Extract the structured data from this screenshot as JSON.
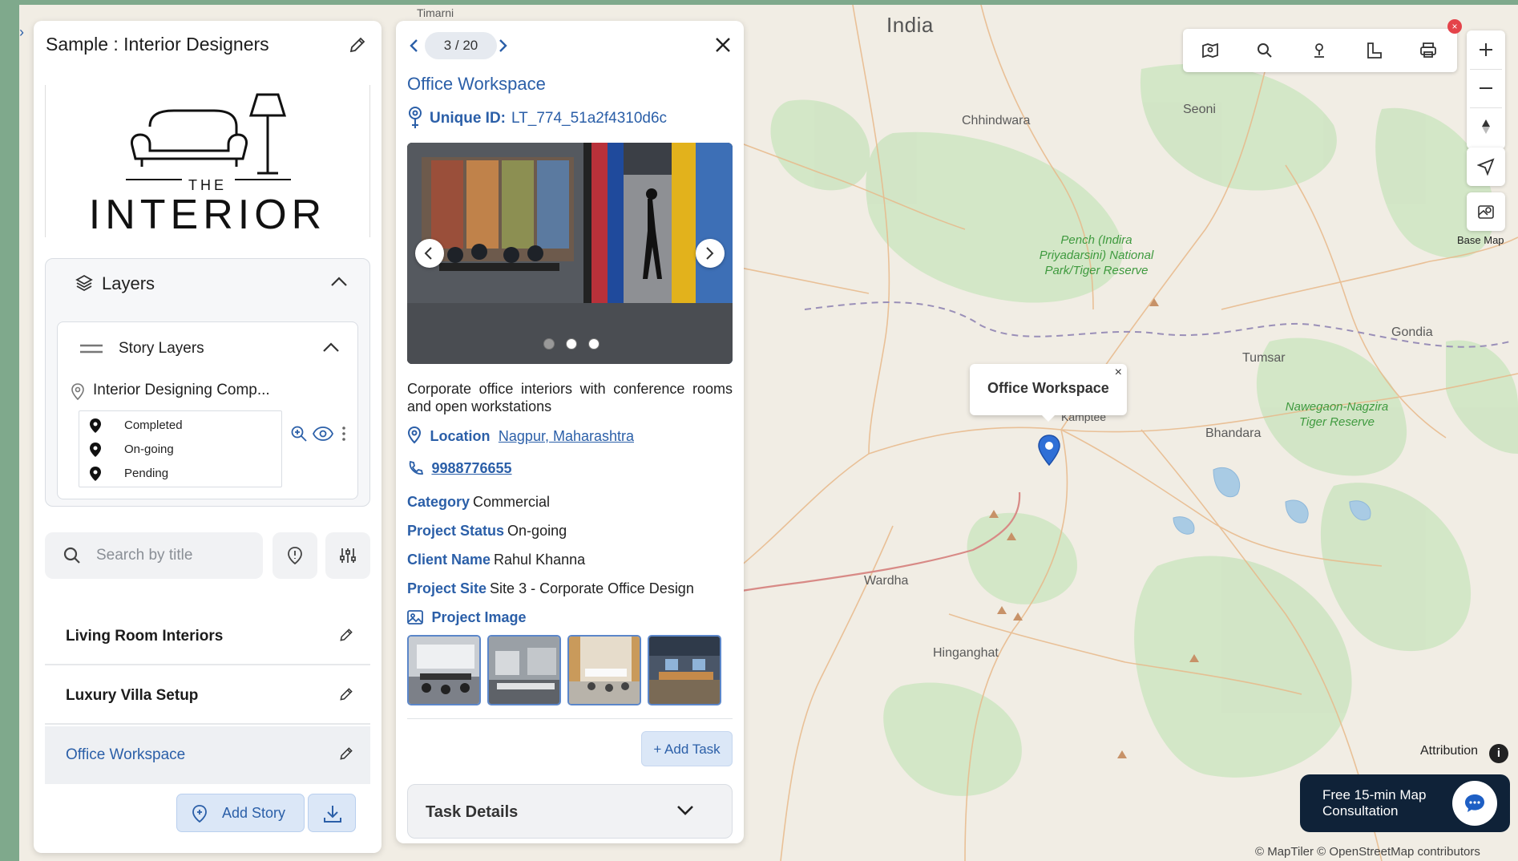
{
  "map": {
    "labels": {
      "country": "India",
      "chhindwara": "Chhindwara",
      "seoni": "Seoni",
      "gondia": "Gondia",
      "tumsar": "Tumsar",
      "bhandara": "Bhandara",
      "kamptee": "Kamptee",
      "wardha": "Wardha",
      "hinganghat": "Hinganghat",
      "timarni": "Timarni",
      "pench": "Pench (Indira Priyadarsini) National Park/Tiger Reserve",
      "nawegaon": "Nawegaon-Nagzira Tiger Reserve"
    },
    "popup_label": "Office Workspace",
    "popup_close": "×",
    "base_map_label": "Base Map",
    "attribution_label": "Attribution",
    "attribution_icon": "i",
    "consult_label": "Free 15-min Map Consultation",
    "copyright": "© MapTiler © OpenStreetMap contributors",
    "toolbar_close": "×"
  },
  "left_panel": {
    "title": "Sample : Interior Designers",
    "logo_the": "THE",
    "logo_text": "INTERIOR",
    "layers_label": "Layers",
    "story_layers_label": "Story Layers",
    "layer_name": "Interior Designing Comp...",
    "legend": [
      {
        "label": "Completed"
      },
      {
        "label": "On-going"
      },
      {
        "label": "Pending"
      }
    ],
    "search_placeholder": "Search by title",
    "stories": [
      {
        "label": "Living Room Interiors"
      },
      {
        "label": "Luxury Villa Setup"
      },
      {
        "label": "Office Workspace"
      }
    ],
    "add_story_label": "Add Story"
  },
  "detail": {
    "pager": "3 / 20",
    "title": "Office Workspace",
    "uid_key": "Unique ID:",
    "uid_val": "LT_774_51a2f4310d6c",
    "description": "Corporate office interiors with conference rooms and open workstations",
    "location_key": "Location",
    "location_val": "Nagpur, Maharashtra",
    "phone": "9988776655",
    "category_key": "Category",
    "category_val": "Commercial",
    "status_key": "Project Status",
    "status_val": "On-going",
    "client_key": "Client Name",
    "client_val": "Rahul Khanna",
    "site_key": "Project Site",
    "site_val": "Site 3 - Corporate Office Design",
    "image_key": "Project Image",
    "add_task": "+ Add Task",
    "task_details": "Task Details"
  },
  "colors": {
    "accent": "#2b5fa8",
    "pin": "#2f6fd6"
  }
}
